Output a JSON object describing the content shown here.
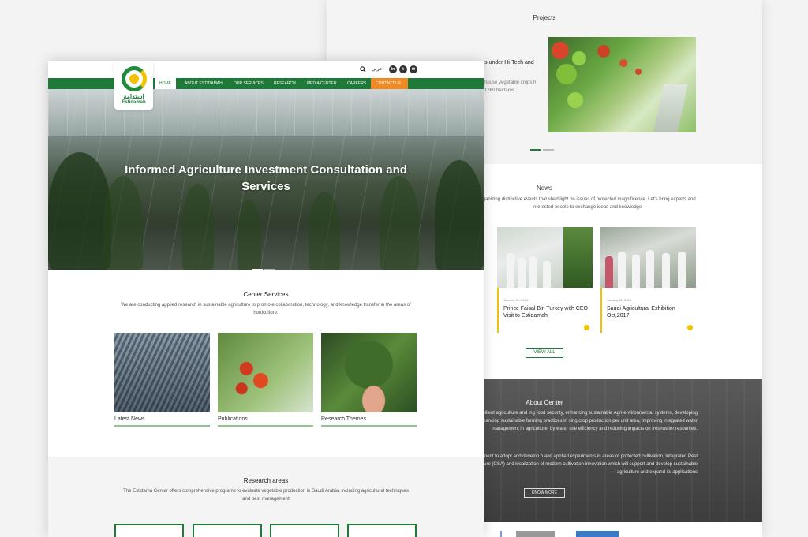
{
  "back": {
    "projects": {
      "title": "Projects",
      "text1": "s under Hi-Tech and",
      "text2": "house vegetable crops h 1260 hectares"
    },
    "news": {
      "title": "News",
      "desc": "organizing distinctive events that shed light on issues of protected magnificence. Let's bring experts and interested people to exchange ideas and knowledge",
      "cards": [
        {
          "date": "January 31, 2024",
          "title": "Prince Faisal Bin Turkey with CEO Visit to Estidamah"
        },
        {
          "date": "January 31, 2024",
          "title": "Saudi Agricultural Exhibition Oct,2017"
        }
      ],
      "view_all": "VIEW ALL"
    },
    "about": {
      "title": "About Center",
      "p1": "orm applied research and seek innovative solutions for sustainable and resilient agriculture and ing food security, enhancing sustainable Agri-environmental systems, developing measures for ms. It strives to adopt and test novel technologies for enhancing sustainable farming practices in sing crop production per unit area, improving integrated water management in agriculture, by water use efficiency and reducing impacts on freshwater resources.",
      "p2": "edge management, research collaboration and effective empowerment to adopt and develop h and applied experiments in areas of protected cultivation, Integrated Pest Management (IPM), ent of organic waste, Climate Smart Agriculture (CSA) and localization of modern cultivation innovation which will support and develop sustainable agriculture and expand its applications",
      "know_more": "KNOW MORE"
    }
  },
  "front": {
    "logo": {
      "arabic": "استدامة",
      "english": "Estidamah"
    },
    "topbar": {
      "lang": "عربي",
      "social": [
        "in",
        "t",
        "✉"
      ]
    },
    "nav": [
      "HOME",
      "ABOUT ESTIDAMAH",
      "OUR SERVICES",
      "RESEARCH",
      "MEDIA CENTER",
      "CAREERS",
      "CONTACT US"
    ],
    "hero": {
      "title": "Informed Agriculture Investment Consultation and Services"
    },
    "center_services": {
      "title": "Center Services",
      "desc": "We are conducting applied research in sustainable agriculture to promote collaboration, technology, and knowledge transfer in the areas of horticulture.",
      "items": [
        "Latest News",
        "Publications",
        "Research Themes"
      ]
    },
    "research_areas": {
      "title": "Research areas",
      "desc": "The Estidama Center offers comprehensive programs to evaluate vegetable production in Saudi Arabia, including agricultural techniques and pest management"
    }
  },
  "colors": {
    "brand_green": "#1f7a3a",
    "accent_orange": "#f08a24",
    "accent_yellow": "#f2c200"
  }
}
